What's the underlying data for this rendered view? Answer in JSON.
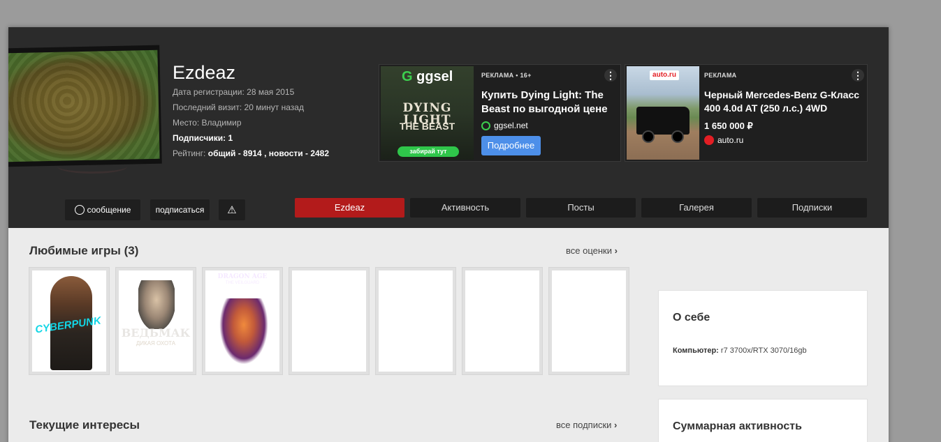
{
  "profile": {
    "username": "Ezdeaz",
    "registration_label": "Дата регистрации:",
    "registration_date": "28 мая 2015",
    "last_visit_label": "Последний визит:",
    "last_visit": "20 минут назад",
    "location_label": "Место:",
    "location": "Владимир",
    "followers_label": "Подписчики:",
    "followers": "1",
    "rating_label": "Рейтинг:",
    "rating_total_label": "общий -",
    "rating_total": "8914",
    "rating_news_label": ", новости -",
    "rating_news": "2482"
  },
  "ads": [
    {
      "label": "РЕКЛАМА • 16+",
      "title": "Купить Dying Light: The Beast по выгодной цене",
      "domain": "ggsel.net",
      "button": "Подробнее",
      "brand": "ggsel",
      "img_title": "DYING LIGHT",
      "img_subtitle": "THE BEAST",
      "img_pill": "забирай тут"
    },
    {
      "label": "РЕКЛАМА",
      "title": "Черный Mercedes-Benz G-Класс 400 4.0d AT (250 л.с.) 4WD",
      "price": "1 650 000 ₽",
      "domain": "auto.ru",
      "brand": "auto.ru"
    }
  ],
  "actions": {
    "message": "сообщение",
    "subscribe": "подписаться"
  },
  "tabs": [
    "Ezdeaz",
    "Активность",
    "Посты",
    "Галерея",
    "Подписки"
  ],
  "favorites": {
    "title": "Любимые игры (3)",
    "link": "все оценки",
    "games": [
      {
        "cover_text": "CYBERPUNK"
      },
      {
        "cover_text": "ВЕДЬМАК",
        "cover_sub": "ДИКАЯ ОХОТА"
      },
      {
        "cover_text": "DRAGON AGE",
        "cover_sub": "THE VEILGUARD"
      }
    ]
  },
  "interests": {
    "title": "Текущие интересы",
    "link": "все подписки"
  },
  "about": {
    "title": "О себе",
    "computer_label": "Компьютер:",
    "computer": "r7 3700x/RTX 3070/16gb"
  },
  "activity": {
    "title": "Суммарная активность"
  },
  "colors": {
    "header_bg": "#2b2b2b",
    "active_tab": "#b31b1b",
    "ad_button": "#4d8fe9",
    "ggsel_green": "#3ccf4e"
  }
}
